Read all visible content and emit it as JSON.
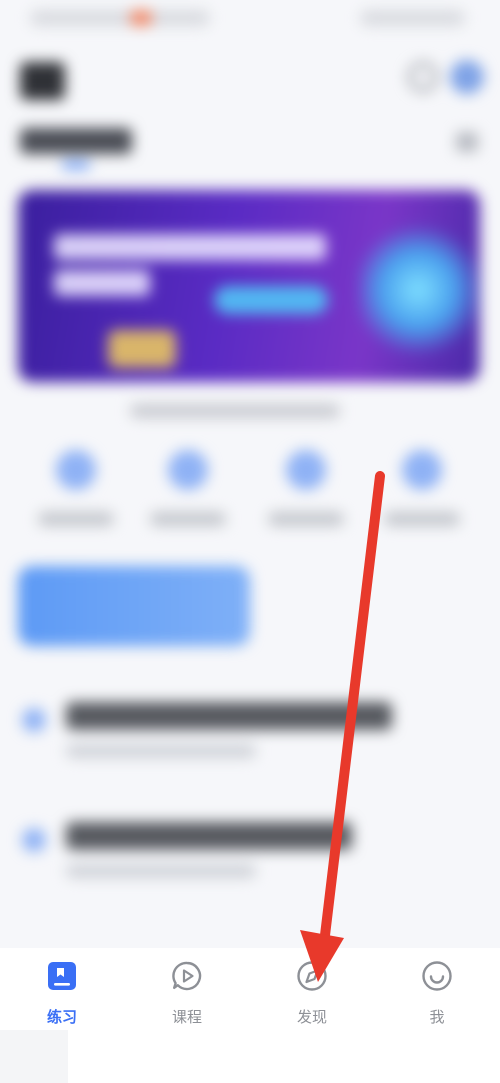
{
  "tabbar": {
    "tabs": [
      {
        "label": "练习",
        "icon": "book-icon",
        "active": true
      },
      {
        "label": "课程",
        "icon": "play-bubble-icon",
        "active": false
      },
      {
        "label": "发现",
        "icon": "compass-icon",
        "active": false
      },
      {
        "label": "我",
        "icon": "smiley-icon",
        "active": false
      }
    ]
  },
  "colors": {
    "accent": "#3a6ff5",
    "inactive": "#8d9096",
    "annotation_arrow": "#e8392b",
    "banner": "#4a2aa8"
  }
}
